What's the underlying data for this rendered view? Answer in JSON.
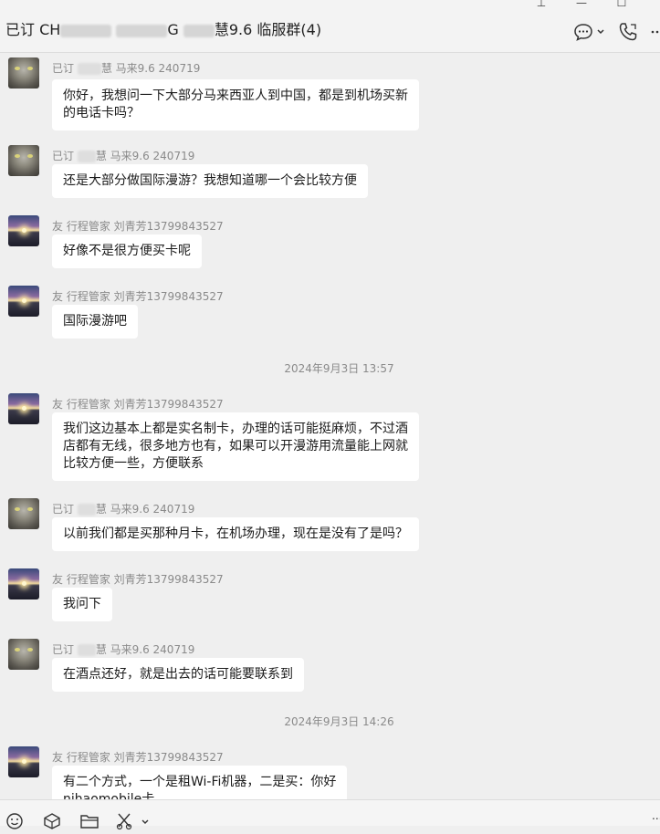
{
  "window": {
    "pin": "⊥",
    "minimize": "—",
    "maximize": "☐"
  },
  "header": {
    "title_prefix": "已订 CH",
    "title_mid": "G ",
    "title_suffix": "慧9.6  临服群(4)"
  },
  "messages": [
    {
      "avatar": "cat-avatar",
      "sender_prefix": "已订 ",
      "sender": "慧 马来9.6 240719",
      "lines": [
        "你好，我想问一下大部分马来西亚人到中国，都是到机场买新",
        "的电话卡吗？"
      ]
    },
    {
      "avatar": "cat-avatar",
      "sender_prefix": "已订 ",
      "sender": "慧 马来9.6 240719",
      "lines": [
        "还是大部分做国际漫游？我想知道哪一个会比较方便"
      ]
    },
    {
      "avatar": "road-avatar",
      "sender_prefix": "",
      "sender": "友 行程管家 刘青芳13799843527",
      "lines": [
        "好像不是很方便买卡呢"
      ]
    },
    {
      "avatar": "road-avatar",
      "sender_prefix": "",
      "sender": "友 行程管家 刘青芳13799843527",
      "lines": [
        "国际漫游吧"
      ]
    },
    {
      "avatar": "road-avatar",
      "sender_prefix": "",
      "sender": "友 行程管家 刘青芳13799843527",
      "lines": [
        "我们这边基本上都是实名制卡，办理的话可能挺麻烦，不过酒",
        "店都有无线，很多地方也有，如果可以开漫游用流量能上网就",
        "比较方便一些，方便联系"
      ]
    },
    {
      "avatar": "cat-avatar",
      "sender_prefix": "已订 ",
      "sender": "慧 马来9.6 240719",
      "lines": [
        "以前我们都是买那种月卡，在机场办理，现在是没有了是吗？"
      ]
    },
    {
      "avatar": "road-avatar",
      "sender_prefix": "",
      "sender": "友 行程管家 刘青芳13799843527",
      "lines": [
        "我问下"
      ]
    },
    {
      "avatar": "cat-avatar",
      "sender_prefix": "已订 ",
      "sender": "慧 马来9.6 240719",
      "lines": [
        "在酒点还好，就是出去的话可能要联系到"
      ]
    },
    {
      "avatar": "road-avatar",
      "sender_prefix": "",
      "sender": "友 行程管家 刘青芳13799843527",
      "lines": [
        "有二个方式，一个是租Wi-Fi机器，二是买：你好",
        "nihaomobile卡"
      ]
    }
  ],
  "timestamps": [
    "2024年9月3日 13:57",
    "2024年9月3日 14:26"
  ],
  "toolbar": {
    "more": "..."
  }
}
